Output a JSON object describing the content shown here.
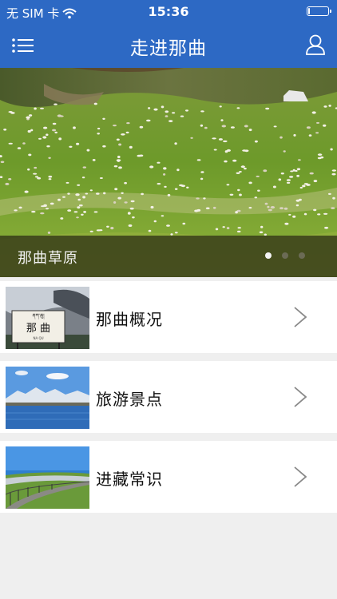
{
  "status_bar": {
    "carrier": "无 SIM 卡",
    "time": "15:36",
    "battery_level": 0.1
  },
  "nav": {
    "title": "走进那曲",
    "menu_icon": "list-menu-icon",
    "user_icon": "user-icon"
  },
  "banner": {
    "caption": "那曲草原",
    "slide_count": 3,
    "active_slide": 1
  },
  "list": {
    "items": [
      {
        "label": "那曲概况",
        "icon": "chevron-right-icon"
      },
      {
        "label": "旅游景点",
        "icon": "chevron-right-icon"
      },
      {
        "label": "进藏常识",
        "icon": "chevron-right-icon"
      }
    ]
  },
  "colors": {
    "nav_bar": "#2d69c4",
    "background": "#efefef",
    "list_bg": "#ffffff"
  }
}
